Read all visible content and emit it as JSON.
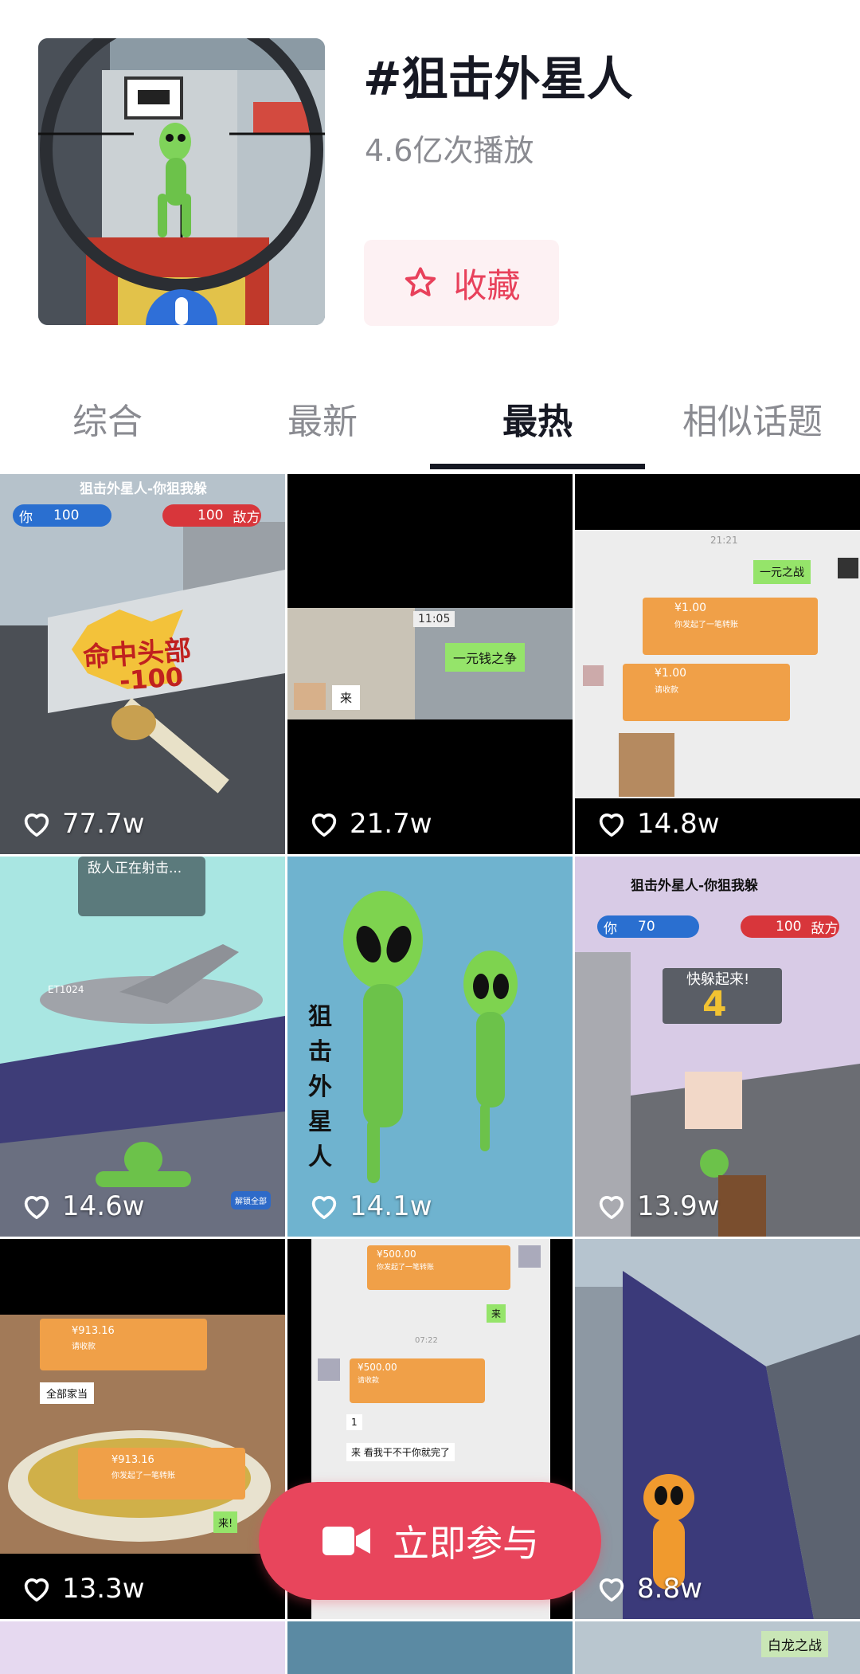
{
  "topic": {
    "title": "#狙击外星人",
    "play_count": "4.6亿次播放",
    "favorite_label": "收藏"
  },
  "tabs": [
    {
      "label": "综合",
      "active": false
    },
    {
      "label": "最新",
      "active": false
    },
    {
      "label": "最热",
      "active": true
    },
    {
      "label": "相似话题",
      "active": false
    }
  ],
  "videos": [
    {
      "likes": "77.7w",
      "overlay": {
        "banner": "狙击外星人-你狙我躲",
        "left_label": "你",
        "left_score": "100",
        "right_score": "100",
        "right_label": "敌方",
        "hit_text": "命中头部",
        "damage": "-100"
      }
    },
    {
      "likes": "21.7w",
      "overlay": {
        "time": "11:05",
        "bubble": "一元钱之争",
        "reply": "来"
      }
    },
    {
      "likes": "14.8w",
      "overlay": {
        "time": "21:21",
        "bubble": "一元之战",
        "amount1": "¥1.00",
        "note1": "你发起了一笔转账",
        "amount2": "¥1.00",
        "note2": "请收款"
      }
    },
    {
      "likes": "14.6w",
      "overlay": {
        "banner": "敌人正在射击...",
        "plane_id": "ET1024",
        "unlock": "解锁全部"
      }
    },
    {
      "likes": "14.1w",
      "overlay": {
        "vertical_text": "狙击外星人"
      }
    },
    {
      "likes": "13.9w",
      "overlay": {
        "banner": "狙击外星人-你狙我躲",
        "left_label": "你",
        "left_score": "70",
        "right_score": "100",
        "right_label": "敌方",
        "count_title": "快躲起来!",
        "count": "4"
      }
    },
    {
      "likes": "13.3w",
      "overlay": {
        "amount1": "¥913.16",
        "note1": "请收款",
        "chat1": "全部家当",
        "amount2": "¥913.16",
        "note2": "你发起了一笔转账",
        "chat2": "来!"
      }
    },
    {
      "likes": "",
      "overlay": {
        "amount1": "¥500.00",
        "note1": "你发起了一笔转账",
        "reply1": "来",
        "time": "07:22",
        "amount2": "¥500.00",
        "note2": "请收款",
        "chat1": "1",
        "chat2": "来 看我干不干你就完了"
      }
    },
    {
      "likes": "8.8w",
      "overlay": {}
    }
  ],
  "partial_row": {
    "label": "白龙之战"
  },
  "join_button": {
    "label": "立即参与"
  },
  "colors": {
    "accent": "#e8455c",
    "fav_bg": "#fdf1f3",
    "text_dark": "#161823",
    "text_gray": "#8a8b91"
  }
}
